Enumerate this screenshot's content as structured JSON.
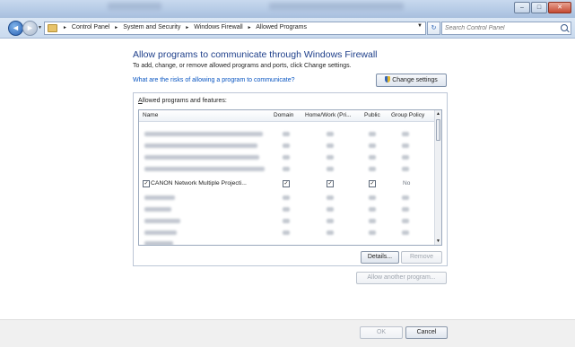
{
  "window": {
    "buttons": {
      "minimize": "–",
      "maximize": "□",
      "close": "✕"
    }
  },
  "address_bar": {
    "back_glyph": "◄",
    "forward_glyph": "►",
    "dropdown_glyph": "▼",
    "refresh_glyph": "↻",
    "breadcrumbs": [
      "Control Panel",
      "System and Security",
      "Windows Firewall",
      "Allowed Programs"
    ],
    "separator": "►",
    "search_placeholder": "Search Control Panel"
  },
  "content": {
    "heading": "Allow programs to communicate through Windows Firewall",
    "subtext": "To add, change, or remove allowed programs and ports, click Change settings.",
    "risk_link": "What are the risks of allowing a program to communicate?",
    "change_settings_label": "Change settings",
    "group_label_prefix": "A",
    "group_label_rest": "llowed programs and features:",
    "columns": {
      "name": "Name",
      "domain": "Domain",
      "home_work": "Home/Work (Pri...",
      "public": "Public",
      "group_policy": "Group Policy"
    },
    "visible_row": {
      "name": "CANON Network Multiple Projecti...",
      "check": "✓",
      "group_policy": "No"
    },
    "scroll": {
      "up": "▲",
      "down": "▼"
    },
    "details_label": "Details...",
    "remove_label": "Remove",
    "allow_another_label": "Allow another program..."
  },
  "footer": {
    "ok_label": "OK",
    "cancel_label": "Cancel"
  }
}
